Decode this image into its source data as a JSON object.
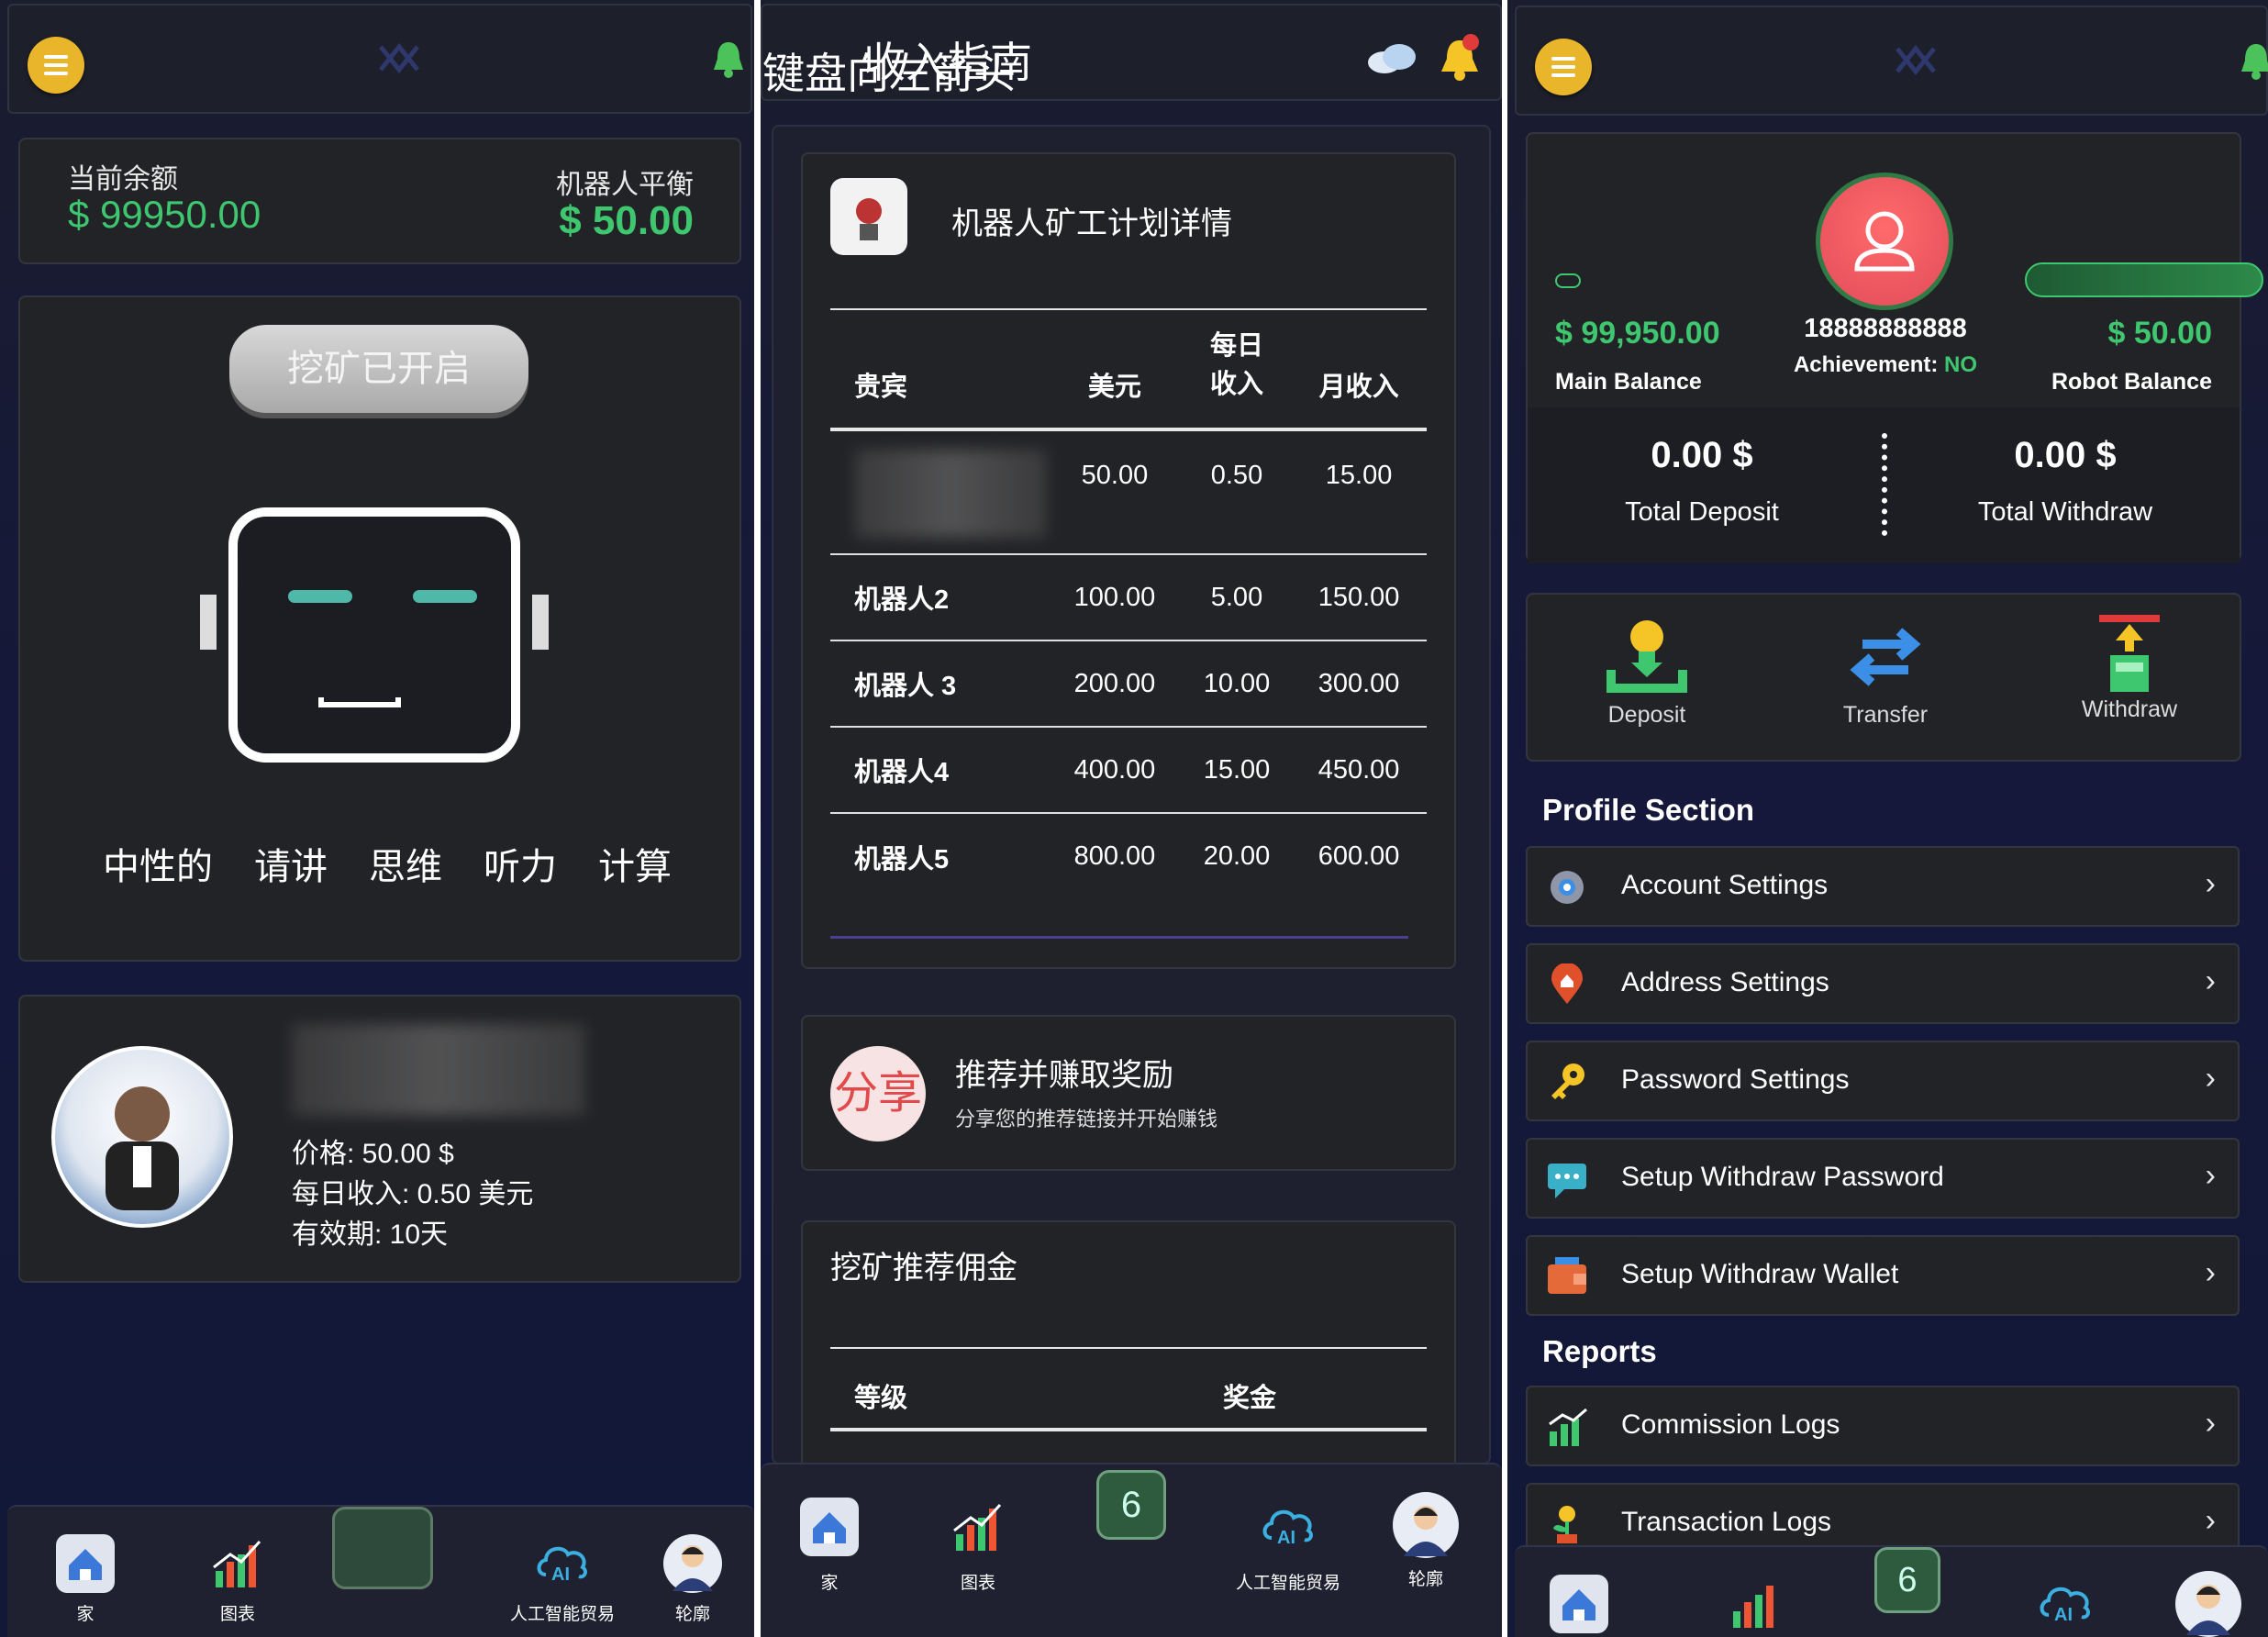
{
  "colors": {
    "accent_green": "#3fc76f",
    "gold": "#e9b52a",
    "card": "#222327",
    "background": "#15183a"
  },
  "panel1": {
    "balance": {
      "current_label": "当前余额",
      "current_value": "$ 99950.00",
      "robot_label": "机器人平衡",
      "robot_value": "$ 50.00"
    },
    "mining_button": "挖矿已开启",
    "robot_modes": [
      "中性的",
      "请讲",
      "思维",
      "听力",
      "计算"
    ],
    "plan": {
      "price": "价格: 50.00 $",
      "daily": "每日收入: 0.50 美元",
      "validity": "有效期: 10天"
    },
    "nav": [
      {
        "label": "家",
        "icon": "home-icon"
      },
      {
        "label": "图表",
        "icon": "chart-icon"
      },
      {
        "label": "",
        "icon": "chip-icon"
      },
      {
        "label": "人工智能贸易",
        "icon": "ai-cloud-icon"
      },
      {
        "label": "轮廓",
        "icon": "profile-avatar-icon"
      }
    ]
  },
  "panel2": {
    "header_title_a": "键盘向左箭头",
    "header_title_b": "收入指南",
    "plan_card_title": "机器人矿工计划详情",
    "table_headers": [
      "贵宾",
      "美元",
      "每日\n收入",
      "月收入"
    ],
    "rows": [
      {
        "name": "",
        "usd": "50.00",
        "daily": "0.50",
        "monthly": "15.00"
      },
      {
        "name": "机器人2",
        "usd": "100.00",
        "daily": "5.00",
        "monthly": "150.00"
      },
      {
        "name": "机器人 3",
        "usd": "200.00",
        "daily": "10.00",
        "monthly": "300.00"
      },
      {
        "name": "机器人4",
        "usd": "400.00",
        "daily": "15.00",
        "monthly": "450.00"
      },
      {
        "name": "机器人5",
        "usd": "800.00",
        "daily": "20.00",
        "monthly": "600.00"
      }
    ],
    "referral": {
      "badge": "分享",
      "title": "推荐并赚取奖励",
      "subtitle": "分享您的推荐链接并开始赚钱"
    },
    "commission": {
      "title": "挖矿推荐佣金",
      "col_level": "等级",
      "col_bonus": "奖金"
    },
    "nav": [
      {
        "label": "家",
        "icon": "home-icon"
      },
      {
        "label": "图表",
        "icon": "chart-icon"
      },
      {
        "label": "",
        "icon": "chip-icon"
      },
      {
        "label": "人工智能贸易",
        "icon": "ai-cloud-icon"
      },
      {
        "label": "轮廓",
        "icon": "profile-avatar-icon"
      }
    ]
  },
  "panel3": {
    "main_balance": "$ 99,950.00",
    "main_balance_label": "Main Balance",
    "phone": "18888888888",
    "achievement_label": "Achievement:",
    "achievement_value": "NO",
    "robot_balance": "$ 50.00",
    "robot_balance_label": "Robot Balance",
    "total_deposit": "0.00 $",
    "total_deposit_label": "Total Deposit",
    "total_withdraw": "0.00 $",
    "total_withdraw_label": "Total Withdraw",
    "actions": [
      {
        "label": "Deposit",
        "icon": "deposit-icon"
      },
      {
        "label": "Transfer",
        "icon": "transfer-icon"
      },
      {
        "label": "Withdraw",
        "icon": "withdraw-icon"
      }
    ],
    "profile_section_title": "Profile Section",
    "profile_items": [
      {
        "label": "Account Settings",
        "icon": "gear-icon"
      },
      {
        "label": "Address Settings",
        "icon": "location-pin-icon"
      },
      {
        "label": "Password Settings",
        "icon": "key-icon"
      },
      {
        "label": "Setup Withdraw Password",
        "icon": "chat-bubble-icon"
      },
      {
        "label": "Setup Withdraw Wallet",
        "icon": "wallet-icon"
      }
    ],
    "reports_title": "Reports",
    "report_items": [
      {
        "label": "Commission Logs",
        "icon": "commission-chart-icon"
      },
      {
        "label": "Transaction Logs",
        "icon": "plant-coin-icon"
      }
    ]
  }
}
